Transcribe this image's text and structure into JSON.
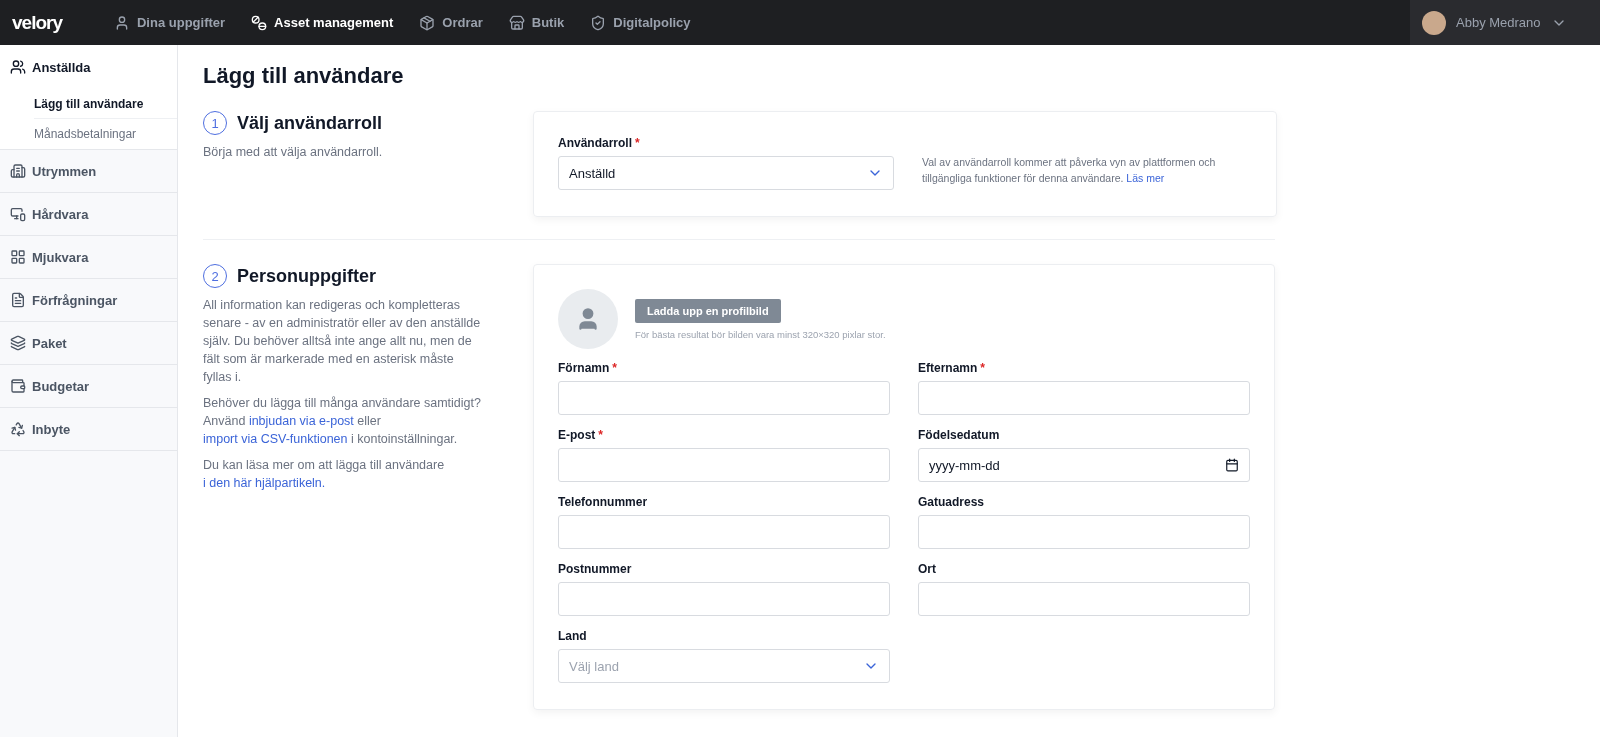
{
  "topbar": {
    "logo": "velory",
    "nav": [
      {
        "label": "Dina uppgifter",
        "selected": false
      },
      {
        "label": "Asset management",
        "selected": true
      },
      {
        "label": "Ordrar",
        "selected": false
      },
      {
        "label": "Butik",
        "selected": false
      },
      {
        "label": "Digitalpolicy",
        "selected": false
      }
    ],
    "user": {
      "name": "Abby Medrano"
    }
  },
  "sidebar": {
    "items": [
      {
        "label": "Anställda",
        "expanded": true,
        "children": [
          {
            "label": "Lägg till användare",
            "selected": true
          },
          {
            "label": "Månadsbetalningar",
            "selected": false
          }
        ]
      },
      {
        "label": "Utrymmen",
        "expanded": false
      },
      {
        "label": "Hårdvara",
        "expanded": false
      },
      {
        "label": "Mjukvara",
        "expanded": false
      },
      {
        "label": "Förfrågningar",
        "expanded": false
      },
      {
        "label": "Paket",
        "expanded": false
      },
      {
        "label": "Budgetar",
        "expanded": false
      },
      {
        "label": "Inbyte",
        "expanded": false
      }
    ]
  },
  "page": {
    "title": "Lägg till användare",
    "sections": [
      {
        "number": "1",
        "title": "Välj användarroll",
        "paragraphs": [
          [
            {
              "kind": "text",
              "text": "Börja med att välja användarroll."
            }
          ]
        ],
        "role": {
          "label": "Användarroll",
          "marker": "*",
          "value": "Anställd",
          "help": [
            {
              "kind": "text",
              "text": "Val av användarroll kommer att påverka vyn av plattformen och tillgängliga funktioner för denna användare. "
            },
            {
              "kind": "link",
              "text": "Läs mer"
            }
          ]
        }
      },
      {
        "number": "2",
        "title": "Personuppgifter",
        "paragraphs": [
          [
            {
              "kind": "text",
              "text": "All information kan redigeras och kompletteras senare - av en administratör eller av den anställde själv. Du behöver alltså inte ange allt nu, men de fält som är markerade med en asterisk måste fyllas i."
            }
          ],
          [
            {
              "kind": "text",
              "text": "Behöver du lägga till många användare samtidigt? Använd "
            },
            {
              "kind": "link",
              "text": "inbjudan via e-post"
            },
            {
              "kind": "text",
              "text": " eller "
            },
            {
              "kind": "link",
              "text": "import via CSV-funktionen"
            },
            {
              "kind": "text",
              "text": " i kontoinställningar."
            }
          ],
          [
            {
              "kind": "text",
              "text": "Du kan läsa mer om att lägga till användare "
            },
            {
              "kind": "link",
              "text": "i den här hjälpartikeln."
            }
          ]
        ],
        "upload": {
          "button": "Ladda upp en profilbild",
          "hint": "För bästa resultat bör bilden vara minst 320×320 pixlar stor."
        },
        "fields": [
          {
            "label": "Förnamn",
            "marker": "*",
            "kind": "text"
          },
          {
            "label": "Efternamn",
            "marker": "*",
            "kind": "text"
          },
          {
            "label": "E-post",
            "marker": "*",
            "kind": "text"
          },
          {
            "label": "Födelsedatum",
            "kind": "date",
            "placeholder": "yyyy-mm-dd"
          },
          {
            "label": "Telefonnummer",
            "kind": "text"
          },
          {
            "label": "Gatuadress",
            "kind": "text"
          },
          {
            "label": "Postnummer",
            "kind": "text"
          },
          {
            "label": "Ort",
            "kind": "text"
          },
          {
            "label": "Land",
            "kind": "select",
            "placeholder": "Välj land"
          }
        ]
      }
    ]
  }
}
